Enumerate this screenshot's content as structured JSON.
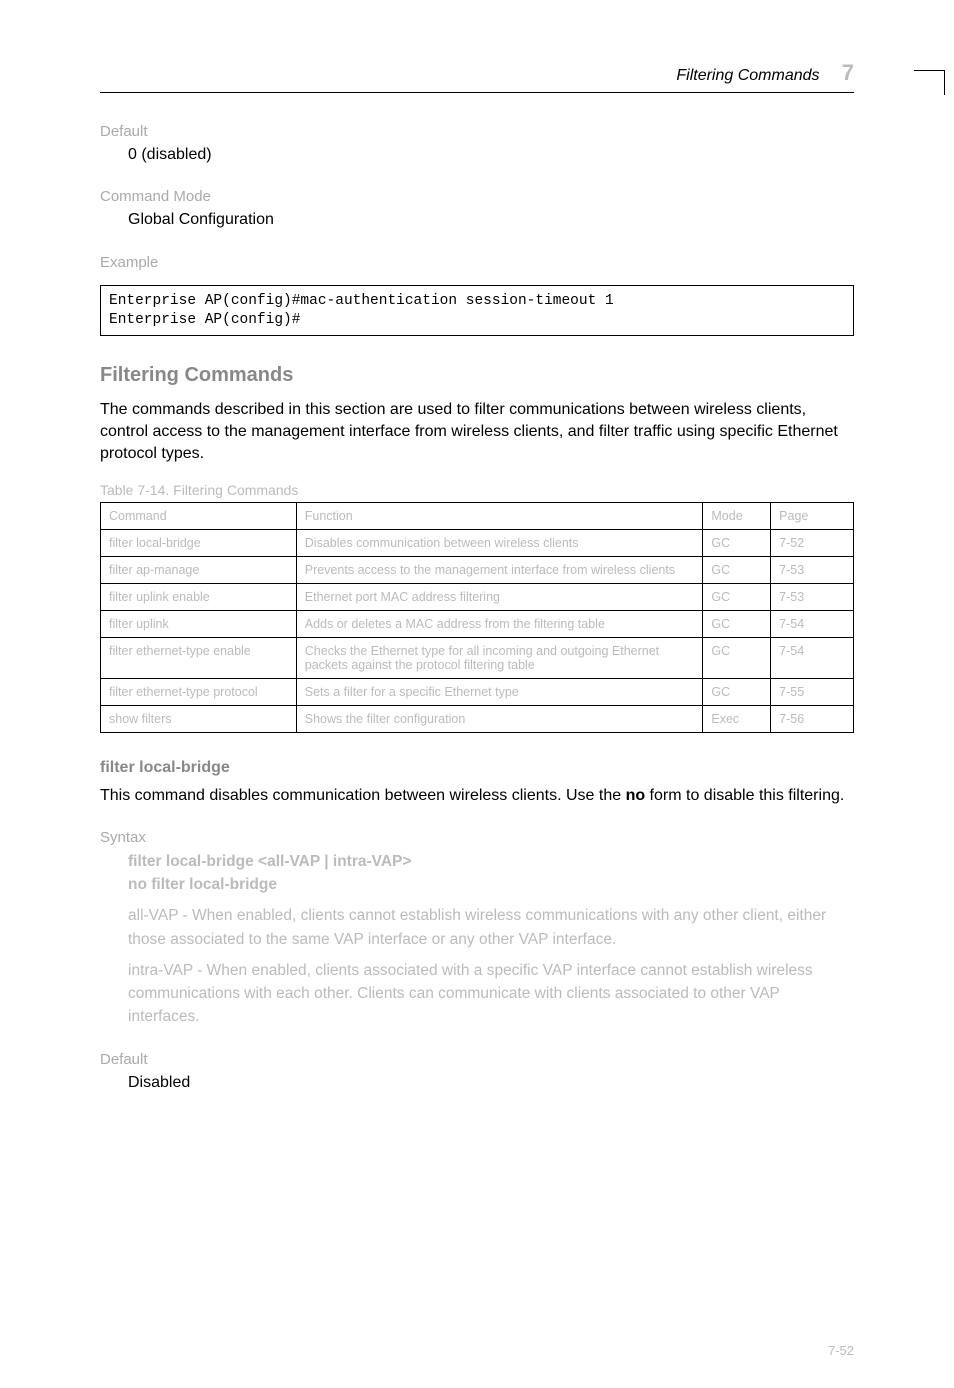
{
  "header": {
    "section_title": "Filtering Commands",
    "section_number": "7"
  },
  "fields": {
    "default_label": "Default",
    "default_value": "0 (disabled)",
    "mode_label": "Command Mode",
    "mode_value": "Global Configuration",
    "example_label": "Example"
  },
  "code": "Enterprise AP(config)#mac-authentication session-timeout 1\nEnterprise AP(config)#",
  "section": {
    "heading": "Filtering Commands",
    "body": "The commands described in this section are used to filter communications between wireless clients, control access to the management interface from wireless clients, and filter traffic using specific Ethernet protocol types."
  },
  "table": {
    "caption": "Table 7-14. Filtering Commands",
    "headers": [
      "Command",
      "Function",
      "Mode",
      "Page"
    ],
    "rows": [
      [
        "filter local-bridge",
        "Disables communication between wireless clients",
        "GC",
        "7-52"
      ],
      [
        "filter ap-manage",
        "Prevents access to the management interface from wireless clients",
        "GC",
        "7-53"
      ],
      [
        "filter uplink enable",
        "Ethernet port MAC address filtering",
        "GC",
        "7-53"
      ],
      [
        "filter uplink",
        "Adds or deletes a MAC address from the filtering table",
        "GC",
        "7-54"
      ],
      [
        "filter ethernet-type enable",
        "Checks the Ethernet type for all incoming and outgoing Ethernet packets against the protocol filtering table",
        "GC",
        "7-54"
      ],
      [
        "filter ethernet-type protocol",
        "Sets a filter for a specific Ethernet type",
        "GC",
        "7-55"
      ],
      [
        "show filters",
        "Shows the filter configuration",
        "Exec",
        "7-56"
      ]
    ]
  },
  "cmd": {
    "name": "filter local-bridge",
    "desc_part1": "This command disables communication between wireless clients. Use the ",
    "desc_no": "no",
    "desc_part2": " form to disable this filtering.",
    "syntax_label": "Syntax",
    "syntax_lines": [
      "filter local-bridge <all-VAP | intra-VAP>",
      "no filter local-bridge"
    ],
    "syntax_detail": [
      "all-VAP - When enabled, clients cannot establish wireless communications with any other client, either those associated to the same VAP interface or any other VAP interface.",
      "intra-VAP - When enabled, clients associated with a specific VAP interface cannot establish wireless communications with each other. Clients can communicate with clients associated to other VAP interfaces."
    ],
    "default_label": "Default",
    "default_value": "Disabled"
  },
  "page_number": "7-52"
}
